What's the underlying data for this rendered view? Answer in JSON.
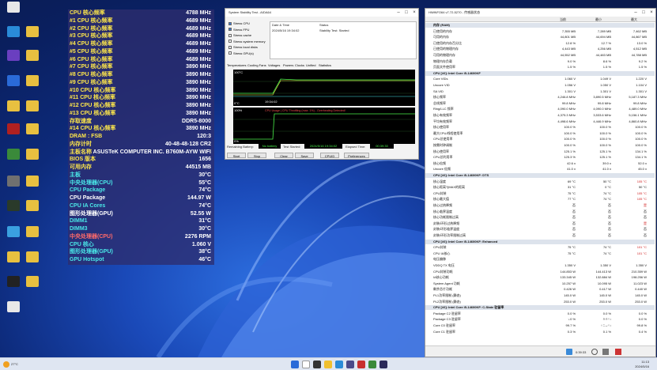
{
  "desktop_icons_left": [
    {
      "label": "",
      "color": "#e8e8e8"
    },
    {
      "label": "",
      "color": "#2a8bd8"
    },
    {
      "label": "",
      "color": "#6a3fc0"
    },
    {
      "label": "",
      "color": "#2a6ad8"
    },
    {
      "label": "",
      "color": "#e8c040"
    },
    {
      "label": "",
      "color": "#b02020"
    },
    {
      "label": "",
      "color": "#3a8a3a"
    },
    {
      "label": "",
      "color": "#707070"
    },
    {
      "label": "",
      "color": "#2a3a2a"
    },
    {
      "label": "",
      "color": "#3aa0e0"
    },
    {
      "label": "",
      "color": "#e8c040"
    },
    {
      "label": "",
      "color": "#222"
    },
    {
      "label": "",
      "color": "#e8e8e8"
    }
  ],
  "osd": {
    "rows": [
      {
        "k": "CPU 核心频率",
        "v": "4788 MHz",
        "c": "#ffe84a"
      },
      {
        "k": "#1 CPU 核心频率",
        "v": "4689 MHz",
        "c": "#ffe84a"
      },
      {
        "k": "#2 CPU 核心频率",
        "v": "4689 MHz",
        "c": "#ffe84a"
      },
      {
        "k": "#3 CPU 核心频率",
        "v": "4689 MHz",
        "c": "#ffe84a"
      },
      {
        "k": "#4 CPU 核心频率",
        "v": "4689 MHz",
        "c": "#ffe84a"
      },
      {
        "k": "#5 CPU 核心频率",
        "v": "4689 MHz",
        "c": "#ffe84a"
      },
      {
        "k": "#6 CPU 核心频率",
        "v": "4689 MHz",
        "c": "#ffe84a"
      },
      {
        "k": "#7 CPU 核心频率",
        "v": "3890 MHz",
        "c": "#ffe84a"
      },
      {
        "k": "#8 CPU 核心频率",
        "v": "3890 MHz",
        "c": "#ffe84a"
      },
      {
        "k": "#9 CPU 核心频率",
        "v": "3890 MHz",
        "c": "#ffe84a"
      },
      {
        "k": "#10 CPU 核心频率",
        "v": "3890 MHz",
        "c": "#ffe84a"
      },
      {
        "k": "#11 CPU 核心频率",
        "v": "3890 MHz",
        "c": "#ffe84a"
      },
      {
        "k": "#12 CPU 核心频率",
        "v": "3890 MHz",
        "c": "#ffe84a"
      },
      {
        "k": "#13 CPU 核心频率",
        "v": "3890 MHz",
        "c": "#ffe84a"
      },
      {
        "k": "存取速度",
        "v": "DDR5-8000",
        "c": "#ffe84a"
      },
      {
        "k": "#14 CPU 核心频率",
        "v": "3890 MHz",
        "c": "#ffe84a"
      },
      {
        "k": "DRAM : FSB",
        "v": "120:3",
        "c": "#ffe84a"
      },
      {
        "k": "内存计时",
        "v": "40-48-48-128 CR2",
        "c": "#ffe84a"
      },
      {
        "k": "主板名称",
        "v": "ASUSTeK COMPUTER INC. B760M-AYW WIFI",
        "c": "#ffe84a"
      },
      {
        "k": "BIOS 版本",
        "v": "1656",
        "c": "#ffe84a"
      },
      {
        "k": "可用内存",
        "v": "44515 MB",
        "c": "#ffe84a"
      },
      {
        "k": "主板",
        "v": "30°C",
        "c": "#4ae8e8"
      },
      {
        "k": "中央处理器(CPU)",
        "v": "55°C",
        "c": "#4ae8e8"
      },
      {
        "k": "CPU Package",
        "v": "74°C",
        "c": "#4ae8e8"
      },
      {
        "k": "CPU Package",
        "v": "144.97 W",
        "c": "#ffffff"
      },
      {
        "k": "CPU IA Cores",
        "v": "74°C",
        "c": "#4ae8e8"
      },
      {
        "k": "图形处理器(GPU)",
        "v": "52.55 W",
        "c": "#ffffff"
      },
      {
        "k": "DIMM1",
        "v": "31°C",
        "c": "#4ae8e8"
      },
      {
        "k": "DIMM3",
        "v": "30°C",
        "c": "#4ae8e8"
      },
      {
        "k": "中央处理器(CPU)",
        "v": "2276 RPM",
        "c": "#ff6a6a"
      },
      {
        "k": "CPU 核心",
        "v": "1.060 V",
        "c": "#4ae8e8"
      },
      {
        "k": "图形处理器(GPU)",
        "v": "38°C",
        "c": "#4ae8e8"
      },
      {
        "k": "GPU Hotspot",
        "v": "46°C",
        "c": "#4ae8e8"
      }
    ]
  },
  "stability": {
    "title": "System Stability Test - AIDA64",
    "checks": [
      "Stress CPU",
      "Stress FPU",
      "Stress cache",
      "Stress system memory",
      "Stress local disks",
      "Stress GPU(s)"
    ],
    "date_header": "Date & Time",
    "status_header": "Status",
    "date_value": "2024/5/16 19:34:02",
    "status_value": "Stability Test: Started",
    "tabs": [
      "Temperatures",
      "Cooling Fans",
      "Voltages",
      "Powers",
      "Clocks",
      "Unified",
      "Statistics"
    ],
    "graph1_top": "100°C",
    "graph1_bottom": "0°C",
    "graph1_time": "19:34:02",
    "graph2_top": "100%",
    "graph2_bottom": "0%",
    "graph2_title": "CPU Usage | CPU Throttling (max: 1%) - Overheating Detected!",
    "battery_label": "Remaining Battery:",
    "battery_value": "No battery",
    "started_label": "Test Started:",
    "started_value": "2024/5/16 19:34:02",
    "elapsed_label": "Elapsed Time:",
    "elapsed_value": "00:39:33",
    "buttons": [
      "Start",
      "Stop",
      "Clear",
      "Save",
      "CPUID",
      "Preferences"
    ]
  },
  "hwinfo": {
    "title": "HWiNFO64 v7.72-5270 - 传感器状态",
    "cols": [
      "当前",
      "最小",
      "最大"
    ],
    "rows": [
      {
        "n": "内存 (RAM)",
        "sec": true
      },
      {
        "n": "已使用的内存",
        "c1": "7,355 MB",
        "c2": "7,289 MB",
        "c3": "7,462 MB"
      },
      {
        "n": "可用的内存",
        "c1": "44,801 MB",
        "c2": "44,694 MB",
        "c3": "44,867 MB"
      },
      {
        "n": "已使用的内存百分比",
        "c1": "12.8 %",
        "c2": "12.7 %",
        "c3": "13.0 %"
      },
      {
        "n": "已使用的物理内存",
        "c1": "4,443 MB",
        "c2": "4,256 MB",
        "c3": "4,512 MB"
      },
      {
        "n": "可用的物理内存",
        "c1": "44,552 MB",
        "c2": "44,483 MB",
        "c3": "44,788 MB"
      },
      {
        "n": "物理内存负载",
        "c1": "9.0 %",
        "c2": "8.6 %",
        "c3": "9.2 %"
      },
      {
        "n": "页面文件使用率",
        "c1": "1.5 %",
        "c2": "1.5 %",
        "c3": "1.5 %"
      },
      {
        "n": "CPU [#0]: Intel Core i5-14600KF",
        "sec": true
      },
      {
        "n": "Core VIDs",
        "c1": "1.060 V",
        "c2": "1.049 V",
        "c3": "1.220 V"
      },
      {
        "n": "Uncore VID",
        "c1": "1.056 V",
        "c2": "1.050 V",
        "c3": "1.104 V"
      },
      {
        "n": "SA VID",
        "c1": "1.301 V",
        "c2": "1.301 V",
        "c3": "1.301 V"
      },
      {
        "n": "核心频率",
        "c1": "4,246.8 MHz",
        "c2": "3,890.5 MHz",
        "c3": "5,187.3 MHz"
      },
      {
        "n": "总线频率",
        "c1": "99.8 MHz",
        "c2": "99.8 MHz",
        "c3": "99.8 MHz"
      },
      {
        "n": "Ring/LLC 频率",
        "c1": "4,090.0 MHz",
        "c2": "4,090.0 MHz",
        "c3": "4,489.0 MHz"
      },
      {
        "n": "核心有效频率",
        "c1": "4,375.3 MHz",
        "c2": "3,533.6 MHz",
        "c3": "5,156.1 MHz"
      },
      {
        "n": "平均有效频率",
        "c1": "4,498.6 MHz",
        "c2": "4,446.9 MHz",
        "c3": "4,860.8 MHz"
      },
      {
        "n": "核心使用率",
        "c1": "100.0 %",
        "c2": "100.0 %",
        "c3": "100.0 %"
      },
      {
        "n": "最大CPU/线程使用率",
        "c1": "100.0 %",
        "c2": "100.0 %",
        "c3": "100.0 %"
      },
      {
        "n": "CPU总使用率",
        "c1": "100.0 %",
        "c2": "100.0 %",
        "c3": "100.0 %"
      },
      {
        "n": "按需时钟调制",
        "c1": "100.0 %",
        "c2": "100.0 %",
        "c3": "100.0 %"
      },
      {
        "n": "核心使用率",
        "c1": "125.1 %",
        "c2": "125.1 %",
        "c3": "134.1 %"
      },
      {
        "n": "CPU总利用率",
        "c1": "125.3 %",
        "c2": "125.1 %",
        "c3": "134.1 %"
      },
      {
        "n": "核心倍频",
        "c1": "42.6 x",
        "c2": "39.0 x",
        "c3": "52.0 x"
      },
      {
        "n": "Uncore 倍频",
        "c1": "41.0 x",
        "c2": "41.0 x",
        "c3": "45.0 x"
      },
      {
        "n": "CPU [#0]: Intel Core i5-14600KF: DTS",
        "sec": true
      },
      {
        "n": "核心温度",
        "c1": "69 °C",
        "c2": "50 °C",
        "c3": "105 °C"
      },
      {
        "n": "核心距离TjMAX的距离",
        "c1": "31 °C",
        "c2": "0 °C",
        "c3": "50 °C"
      },
      {
        "n": "CPU封装",
        "c1": "75 °C",
        "c2": "74 °C",
        "c3": "105 °C"
      },
      {
        "n": "核心最大值",
        "c1": "77 °C",
        "c2": "74 °C",
        "c3": "105 °C"
      },
      {
        "n": "核心过热降频",
        "c1": "否",
        "c2": "否",
        "c3": "是"
      },
      {
        "n": "核心临界温度",
        "c1": "否",
        "c2": "否",
        "c3": "否"
      },
      {
        "n": "核心功耗限制过高",
        "c1": "否",
        "c2": "否",
        "c3": "否"
      },
      {
        "n": "封装/环形过热降频",
        "c1": "否",
        "c2": "否",
        "c3": "是"
      },
      {
        "n": "封装/环形临界温度",
        "c1": "否",
        "c2": "否",
        "c3": "否"
      },
      {
        "n": "封装/环形功率限制过高",
        "c1": "否",
        "c2": "否",
        "c3": "否"
      },
      {
        "n": "CPU [#0]: Intel Core i5-14600KF: Enhanced",
        "sec": true
      },
      {
        "n": "CPU封装",
        "c1": "75 °C",
        "c2": "74 °C",
        "c3": "101 °C"
      },
      {
        "n": "CPU IA核心",
        "c1": "75 °C",
        "c2": "74 °C",
        "c3": "101 °C"
      },
      {
        "n": "电压偏移",
        "c1": "",
        "c2": "",
        "c3": ""
      },
      {
        "n": "VDDQ TX 电压",
        "c1": "1.350 V",
        "c2": "1.350 V",
        "c3": "1.350 V"
      },
      {
        "n": "CPU封装功耗",
        "c1": "144.853 W",
        "c2": "144.413 W",
        "c3": "210.359 W"
      },
      {
        "n": "IA核心功耗",
        "c1": "133.345 W",
        "c2": "132.884 W",
        "c3": "198.256 W"
      },
      {
        "n": "System Agent 功耗",
        "c1": "10.257 W",
        "c2": "10.095 W",
        "c3": "11.023 W"
      },
      {
        "n": "剩余芯片功耗",
        "c1": "0.426 W",
        "c2": "0.417 W",
        "c3": "0.440 W"
      },
      {
        "n": "PL1功率限制 (静态)",
        "c1": "145.0 W",
        "c2": "145.0 W",
        "c3": "145.0 W"
      },
      {
        "n": "PL2功率限制 (静态)",
        "c1": "253.0 W",
        "c2": "253.0 W",
        "c3": "253.0 W"
      },
      {
        "n": "CPU [#0]: Intel Core i5-14600KF: C-State 驻留率",
        "sec": true
      },
      {
        "n": "Package C2 驻留率",
        "c1": "0.0 %",
        "c2": "0.0 %",
        "c3": "0.0 %"
      },
      {
        "n": "Package C3 驻留率",
        "c1": "0.0 %",
        "c2": "0.0 %",
        "c3": "0.0 %"
      },
      {
        "n": "Core C0 驻留率",
        "c1": "99.7 %",
        "c2": "90.6 %",
        "c3": "99.8 %"
      },
      {
        "n": "Core C1 驻留率",
        "c1": "0.3 %",
        "c2": "0.1 %",
        "c3": "0.4 %"
      }
    ],
    "status_time": "0:39:33"
  },
  "taskbar": {
    "weather": "27°C",
    "time": "11:13",
    "date": "2024/5/16"
  },
  "watermark": "知乎 @何峰"
}
